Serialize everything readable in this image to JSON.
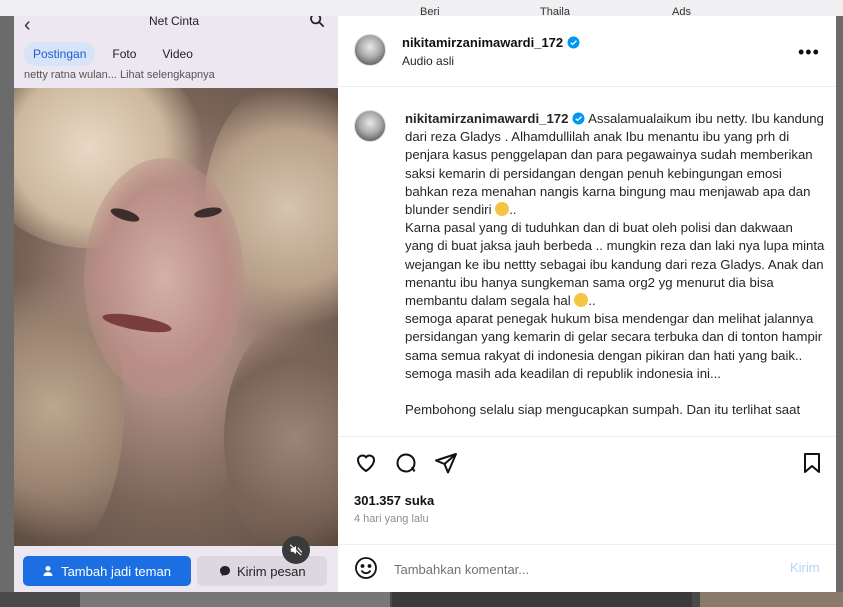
{
  "background": {
    "strip_items": [
      "Net Cinta",
      "Beri",
      "Thaila",
      "Ads"
    ],
    "accent": "#6b6b6b"
  },
  "left_panel": {
    "page_title": "Net Cinta",
    "tabs": [
      {
        "label": "Postingan",
        "active": true
      },
      {
        "label": "Foto",
        "active": false
      },
      {
        "label": "Video",
        "active": false
      }
    ],
    "caption": "netty ratna wulan... Lihat selengkapnya",
    "add_friend_label": "Tambah jadi teman",
    "send_message_label": "Kirim pesan",
    "icons": [
      "back-arrow-icon",
      "search-icon",
      "person-add-icon",
      "messenger-icon",
      "muted-speaker-icon"
    ]
  },
  "post": {
    "username": "nikitamirzanimawardi_172",
    "audio_label": "Audio asli",
    "caption_lines": [
      "Assalamualaikum ibu netty. Ibu kandung dari reza Gladys . Alhamdullilah anak Ibu menantu ibu yang prh di penjara kasus penggelapan dan para pegawainya sudah memberikan saksi kemarin di persidangan dengan penuh kebingungan emosi bahkan reza menahan nangis karna bingung mau menjawab apa dan blunder sendiri",
      "..",
      "Karna pasal yang di tuduhkan dan di buat oleh polisi dan dakwaan yang di buat jaksa jauh berbeda .. mungkin reza dan laki nya lupa minta wejangan ke ibu nettty sebagai ibu kandung dari reza Gladys. Anak dan menantu ibu hanya sungkeman sama org2 yg menurut dia bisa membantu dalam segala hal",
      "..",
      "semoga aparat penegak hukum bisa mendengar dan melihat jalannya persidangan yang kemarin di gelar secara terbuka dan di tonton hampir sama semua rakyat di indonesia dengan pikiran dan hati yang baik..",
      "semoga masih ada keadilan di republik indonesia ini...",
      "Pembohong selalu siap mengucapkan sumpah. Dan itu terlihat saat"
    ],
    "likes": "301.357 suka",
    "time_ago": "4 hari yang lalu",
    "comment_placeholder": "Tambahkan komentar...",
    "post_button": "Kirim",
    "verified_color": "#0095f6",
    "post_button_color": "#b3d3f7"
  }
}
